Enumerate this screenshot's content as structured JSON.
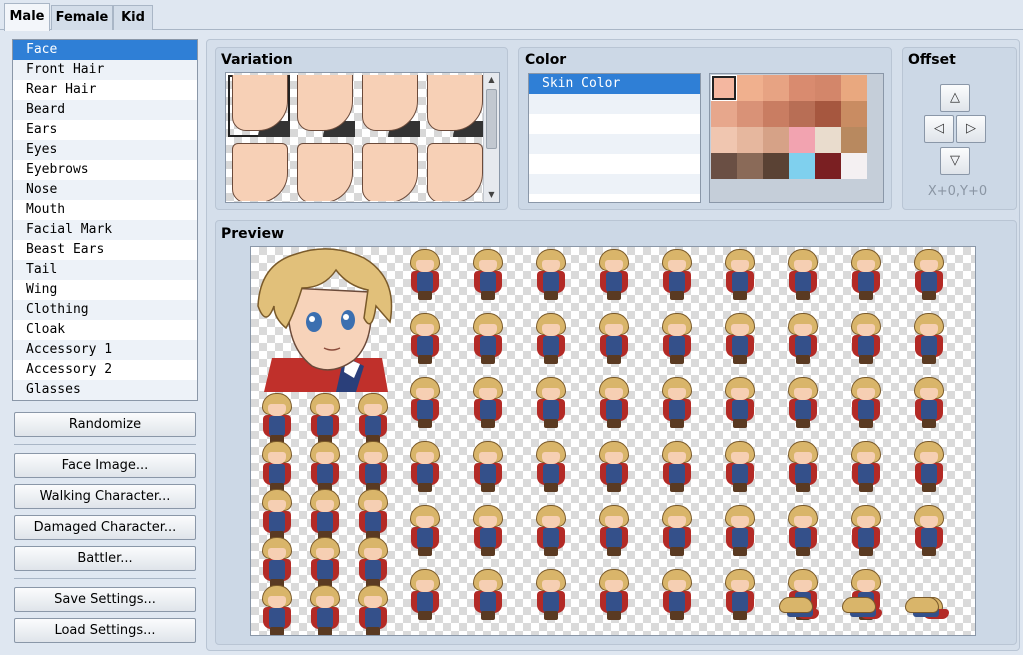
{
  "tabs": [
    "Male",
    "Female",
    "Kid"
  ],
  "parts": [
    "Face",
    "Front Hair",
    "Rear Hair",
    "Beard",
    "Ears",
    "Eyes",
    "Eyebrows",
    "Nose",
    "Mouth",
    "Facial Mark",
    "Beast Ears",
    "Tail",
    "Wing",
    "Clothing",
    "Cloak",
    "Accessory 1",
    "Accessory 2",
    "Glasses"
  ],
  "buttons": {
    "randomize": "Randomize",
    "face_image": "Face Image...",
    "walking_character": "Walking Character...",
    "damaged_character": "Damaged Character...",
    "battler": "Battler...",
    "save_settings": "Save Settings...",
    "load_settings": "Load Settings..."
  },
  "variation": {
    "title": "Variation"
  },
  "color": {
    "title": "Color",
    "items": [
      "Skin Color"
    ],
    "palette": [
      "#f4b7a0",
      "#f0b08e",
      "#e7a383",
      "#d98b6f",
      "#d3866a",
      "#e9a87f",
      "#e7a78c",
      "#d99277",
      "#c97d62",
      "#b86e55",
      "#a6573f",
      "#c98c62",
      "#f0c6b0",
      "#e6b79e",
      "#d6a287",
      "#f2a3b0",
      "#e9dccd",
      "#b8895f",
      "#6a4f44",
      "#8a6a58",
      "#5a4234",
      "#7fd0ee",
      "#7a1f22",
      "#f4f0f2"
    ]
  },
  "offset": {
    "title": "Offset",
    "value": "X+0,Y+0"
  },
  "preview": {
    "title": "Preview"
  }
}
